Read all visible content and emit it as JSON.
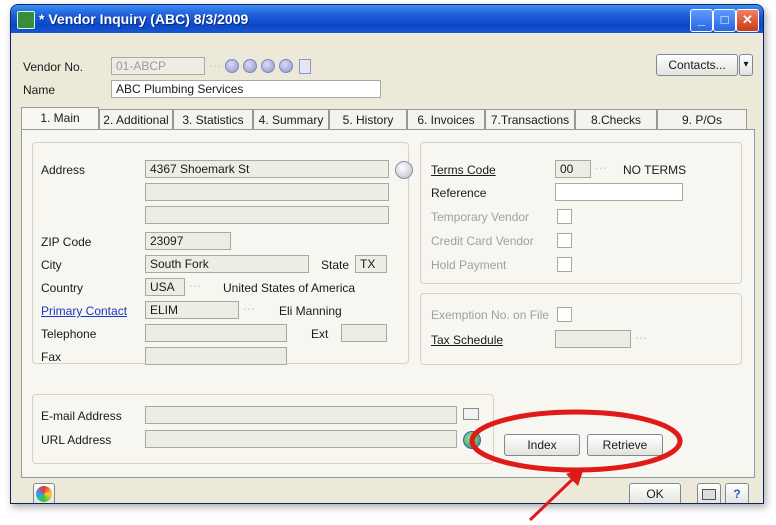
{
  "window": {
    "title": "* Vendor Inquiry (ABC) 8/3/2009",
    "controls": {
      "minimize": "_",
      "maximize": "□",
      "close": "✕"
    }
  },
  "header": {
    "vendor_no_label": "Vendor No.",
    "vendor_no_value": "01-ABCP",
    "name_label": "Name",
    "name_value": "ABC Plumbing Services",
    "contacts_button": "Contacts...",
    "contacts_dropdown": "▾"
  },
  "tabs": [
    {
      "label": "1. Main",
      "active": true
    },
    {
      "label": "2. Additional"
    },
    {
      "label": "3. Statistics"
    },
    {
      "label": "4. Summary"
    },
    {
      "label": "5. History"
    },
    {
      "label": "6. Invoices"
    },
    {
      "label": "7.Transactions"
    },
    {
      "label": "8.Checks"
    },
    {
      "label": "9. P/Os"
    }
  ],
  "address_group": {
    "address_label": "Address",
    "address_line1": "4367 Shoemark St",
    "address_line2": "",
    "address_line3": "",
    "zip_label": "ZIP Code",
    "zip_value": "23097",
    "city_label": "City",
    "city_value": "South Fork",
    "state_label": "State",
    "state_value": "TX",
    "country_label": "Country",
    "country_value": "USA",
    "country_name": "United States of America",
    "primary_contact_label": "Primary Contact",
    "primary_contact_value": "ELIM",
    "primary_contact_name": "Eli Manning",
    "telephone_label": "Telephone",
    "telephone_value": "",
    "ext_label": "Ext",
    "ext_value": "",
    "fax_label": "Fax",
    "fax_value": ""
  },
  "terms_group": {
    "terms_code_label": "Terms Code",
    "terms_code_value": "00",
    "terms_desc": "NO TERMS",
    "reference_label": "Reference",
    "reference_value": "",
    "temporary_vendor_label": "Temporary Vendor",
    "credit_card_vendor_label": "Credit Card Vendor",
    "hold_payment_label": "Hold Payment"
  },
  "tax_group": {
    "exemption_label": "Exemption No. on File",
    "tax_schedule_label": "Tax Schedule",
    "tax_schedule_value": ""
  },
  "contact_group": {
    "email_label": "E-mail Address",
    "email_value": "",
    "url_label": "URL Address",
    "url_value": ""
  },
  "buttons": {
    "index": "Index",
    "retrieve": "Retrieve",
    "ok": "OK"
  },
  "colors": {
    "highlight_circle": "#e01919",
    "titlebar": "#0a48c8"
  }
}
